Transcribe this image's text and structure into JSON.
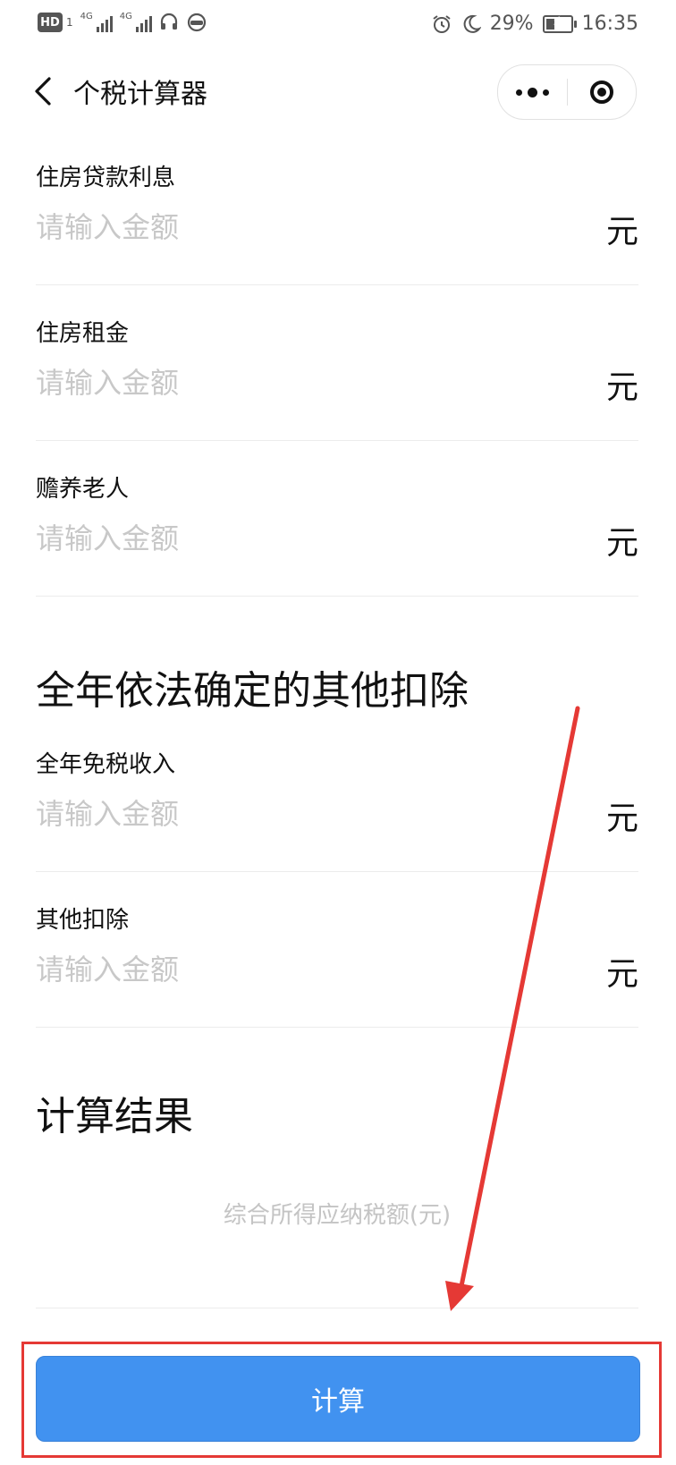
{
  "status_bar": {
    "hd": "HD",
    "sim": "1",
    "net1": "4G",
    "net2": "4G",
    "alarm_icon": "alarm-icon",
    "moon_icon": "moon-icon",
    "battery_percent": "29%",
    "time": "16:35"
  },
  "nav": {
    "title": "个税计算器"
  },
  "fields_top": [
    {
      "label": "住房贷款利息",
      "placeholder": "请输入金额",
      "unit": "元"
    },
    {
      "label": "住房租金",
      "placeholder": "请输入金额",
      "unit": "元"
    },
    {
      "label": "赡养老人",
      "placeholder": "请输入金额",
      "unit": "元"
    }
  ],
  "section_other": {
    "title": "全年依法确定的其他扣除",
    "fields": [
      {
        "label": "全年免税收入",
        "placeholder": "请输入金额",
        "unit": "元"
      },
      {
        "label": "其他扣除",
        "placeholder": "请输入金额",
        "unit": "元"
      }
    ]
  },
  "section_result": {
    "title": "计算结果",
    "result_label": "综合所得应纳税额(元)"
  },
  "calculate_button": {
    "label": "计算"
  },
  "colors": {
    "primary": "#4192f0",
    "annotation": "#e53935",
    "placeholder": "#c8c8c8"
  }
}
